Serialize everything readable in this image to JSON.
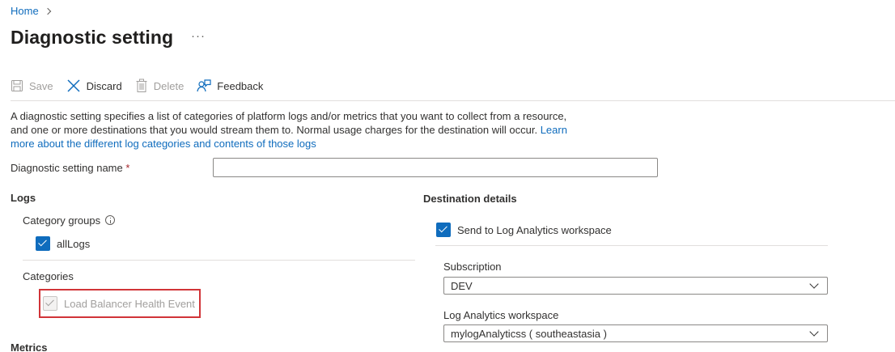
{
  "breadcrumb": {
    "home": "Home"
  },
  "page": {
    "title": "Diagnostic setting",
    "more": "···"
  },
  "toolbar": {
    "save": "Save",
    "discard": "Discard",
    "delete": "Delete",
    "feedback": "Feedback"
  },
  "description": {
    "text": "A diagnostic setting specifies a list of categories of platform logs and/or metrics that you want to collect from a resource, and one or more destinations that you would stream them to. Normal usage charges for the destination will occur. ",
    "link": "Learn more about the different log categories and contents of those logs"
  },
  "name_field": {
    "label": "Diagnostic setting name",
    "required_mark": "*",
    "value": ""
  },
  "logs": {
    "heading": "Logs",
    "category_groups_label": "Category groups",
    "all_logs_label": "allLogs",
    "all_logs_checked": true,
    "categories_label": "Categories",
    "category_item": "Load Balancer Health Event",
    "category_item_checked": true
  },
  "metrics": {
    "heading": "Metrics"
  },
  "destination": {
    "heading": "Destination details",
    "send_law_label": "Send to Log Analytics workspace",
    "send_law_checked": true,
    "subscription_label": "Subscription",
    "subscription_value": "DEV",
    "workspace_label": "Log Analytics workspace",
    "workspace_value": "mylogAnalyticss ( southeastasia )"
  },
  "colors": {
    "accent": "#0f6cbd",
    "highlight_border": "#d13438"
  }
}
